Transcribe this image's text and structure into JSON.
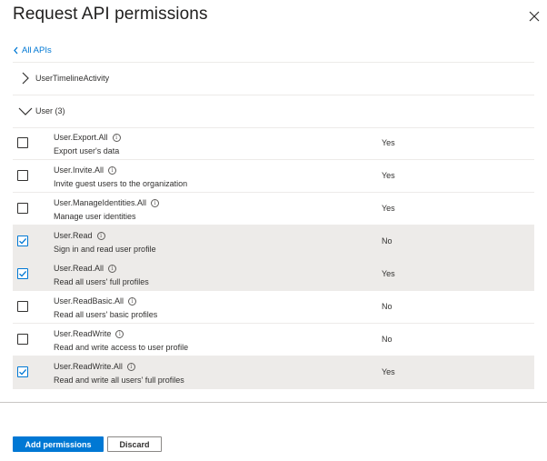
{
  "panel": {
    "title": "Request API permissions",
    "back_link": "All APIs"
  },
  "groups": [
    {
      "label": "UserTimelineActivity",
      "expanded": false
    },
    {
      "label": "User (3)",
      "expanded": true
    }
  ],
  "permissions": [
    {
      "name": "User.Export.All",
      "description": "Export user's data",
      "admin_consent": "Yes",
      "checked": false
    },
    {
      "name": "User.Invite.All",
      "description": "Invite guest users to the organization",
      "admin_consent": "Yes",
      "checked": false
    },
    {
      "name": "User.ManageIdentities.All",
      "description": "Manage user identities",
      "admin_consent": "Yes",
      "checked": false
    },
    {
      "name": "User.Read",
      "description": "Sign in and read user profile",
      "admin_consent": "No",
      "checked": true
    },
    {
      "name": "User.Read.All",
      "description": "Read all users' full profiles",
      "admin_consent": "Yes",
      "checked": true
    },
    {
      "name": "User.ReadBasic.All",
      "description": "Read all users' basic profiles",
      "admin_consent": "No",
      "checked": false
    },
    {
      "name": "User.ReadWrite",
      "description": "Read and write access to user profile",
      "admin_consent": "No",
      "checked": false
    },
    {
      "name": "User.ReadWrite.All",
      "description": "Read and write all users' full profiles",
      "admin_consent": "Yes",
      "checked": true
    }
  ],
  "footer": {
    "primary_label": "Add permissions",
    "secondary_label": "Discard"
  },
  "colors": {
    "accent": "#0078d4",
    "selected_row": "#edebe9"
  },
  "icons": {
    "close": "close-icon",
    "back": "chevron-left-icon",
    "collapsed": "chevron-right-icon",
    "expanded": "chevron-down-icon",
    "info": "info-icon",
    "check": "checkmark-icon"
  }
}
